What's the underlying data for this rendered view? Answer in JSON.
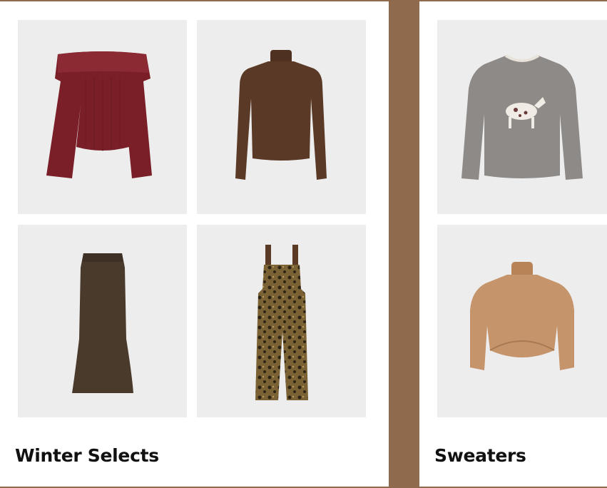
{
  "collections": [
    {
      "title": "Winter Selects",
      "products": [
        {
          "icon": "off-shoulder-ribbed-top-icon",
          "color": "#7a1f28"
        },
        {
          "icon": "turtleneck-top-icon",
          "color": "#5a3a26"
        },
        {
          "icon": "maxi-skirt-icon",
          "color": "#4a3a2c"
        },
        {
          "icon": "leopard-overalls-icon",
          "color": "#6b5630"
        }
      ]
    },
    {
      "title": "Sweaters",
      "products": [
        {
          "icon": "unicorn-sweater-icon",
          "color": "#8d8a87"
        },
        {
          "icon": "camel-turtleneck-sweater-icon",
          "color": "#c6946a"
        }
      ]
    }
  ]
}
